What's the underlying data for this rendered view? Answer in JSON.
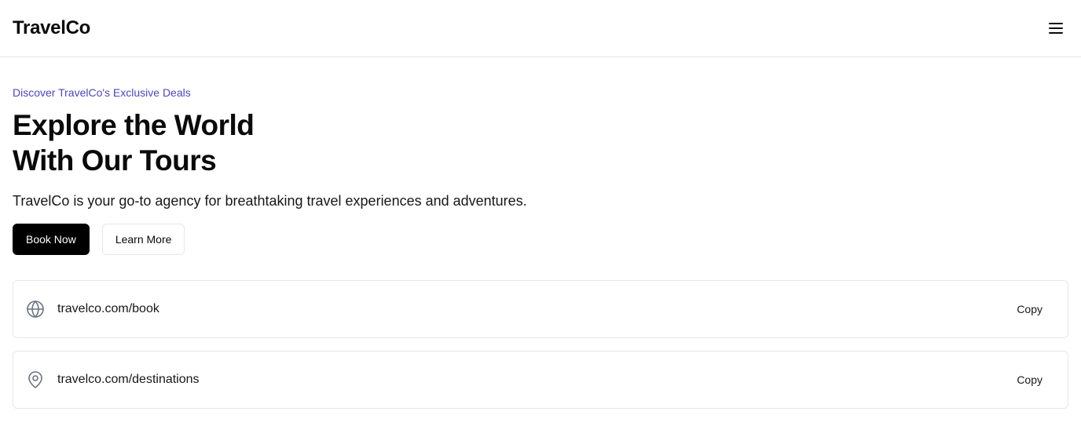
{
  "header": {
    "brand": "TravelCo",
    "menu_icon": "menu-icon"
  },
  "hero": {
    "eyebrow": "Discover TravelCo's Exclusive Deals",
    "title_line1": "Explore the World",
    "title_line2": "With Our Tours",
    "description": "TravelCo is your go-to agency for breathtaking travel experiences and adventures.",
    "primary_button": "Book Now",
    "secondary_button": "Learn More"
  },
  "links": [
    {
      "icon": "globe-icon",
      "url": "travelco.com/book",
      "action": "Copy"
    },
    {
      "icon": "map-pin-icon",
      "url": "travelco.com/destinations",
      "action": "Copy"
    }
  ],
  "colors": {
    "eyebrow": "#4f46b5",
    "primary_button_bg": "#000000",
    "border": "#e5e7eb",
    "icon": "#6b7280"
  }
}
